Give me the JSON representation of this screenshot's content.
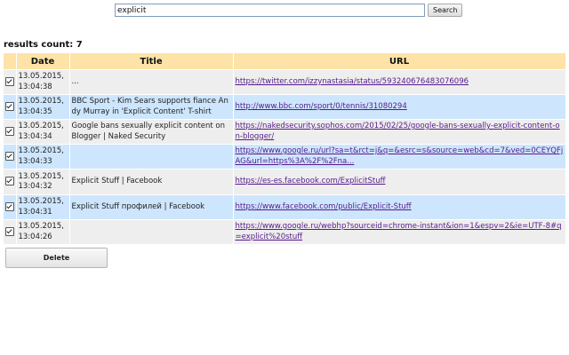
{
  "search": {
    "value": "explicit",
    "button_label": "Search"
  },
  "results": {
    "count_label": "results count: 7"
  },
  "table": {
    "headers": {
      "date": "Date",
      "title": "Title",
      "url": "URL"
    },
    "rows": [
      {
        "checked": true,
        "date": "13.05.2015, 13:04:38",
        "title": "...",
        "url": "https://twitter.com/izzynastasia/status/593240676483076096"
      },
      {
        "checked": true,
        "date": "13.05.2015, 13:04:35",
        "title": "BBC Sport - Kim Sears supports fiance Andy Murray in 'Explicit Content' T-shirt",
        "url": "http://www.bbc.com/sport/0/tennis/31080294"
      },
      {
        "checked": true,
        "date": "13.05.2015, 13:04:34",
        "title": "Google bans sexually explicit content on Blogger | Naked Security",
        "url": "https://nakedsecurity.sophos.com/2015/02/25/google-bans-sexually-explicit-content-on-blogger/"
      },
      {
        "checked": true,
        "date": "13.05.2015, 13:04:33",
        "title": "",
        "url": "https://www.google.ru/url?sa=t&rct=j&q=&esrc=s&source=web&cd=7&ved=0CEYQFjAG&url=https%3A%2F%2Fna..."
      },
      {
        "checked": true,
        "date": "13.05.2015, 13:04:32",
        "title": "Explicit Stuff | Facebook",
        "url": "https://es-es.facebook.com/ExplicitStuff"
      },
      {
        "checked": true,
        "date": "13.05.2015, 13:04:31",
        "title": "Explicit Stuff профилей | Facebook",
        "url": "https://www.facebook.com/public/Explicit-Stuff"
      },
      {
        "checked": true,
        "date": "13.05.2015, 13:04:26",
        "title": "",
        "url": "https://www.google.ru/webhp?sourceid=chrome-instant&ion=1&espv=2&ie=UTF-8#q=explicit%20stuff"
      }
    ]
  },
  "actions": {
    "delete_label": "Delete"
  }
}
